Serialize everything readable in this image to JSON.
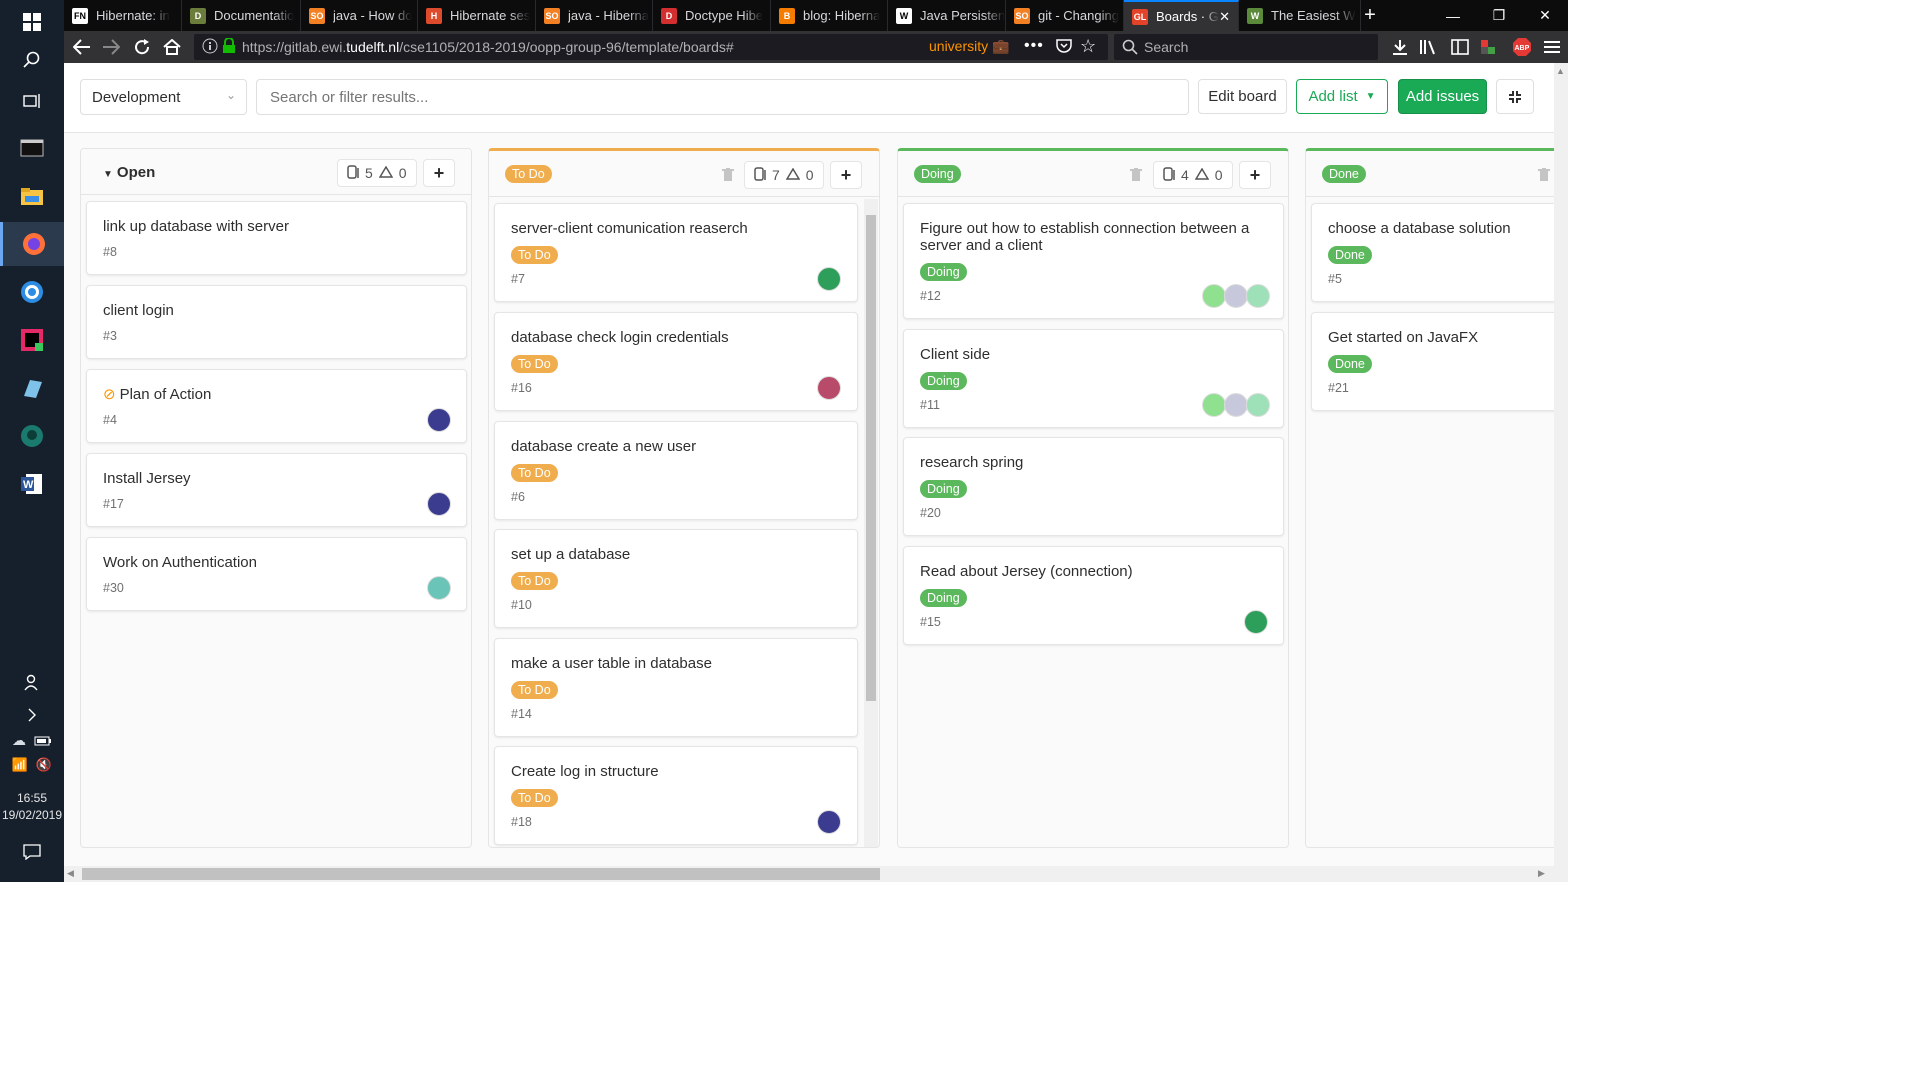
{
  "os": {
    "clock_time": "16:55",
    "clock_date": "19/02/2019"
  },
  "browser": {
    "tabs": [
      {
        "label": "Hibernate: in",
        "favicon": "FN",
        "color": "#ffffff"
      },
      {
        "label": "Documentatio",
        "favicon": "D",
        "color": "#6b7d3a"
      },
      {
        "label": "java - How do",
        "favicon": "SO",
        "color": "#f48024"
      },
      {
        "label": "Hibernate ses",
        "favicon": "H",
        "color": "#de4a2c"
      },
      {
        "label": "java - Hiberna",
        "favicon": "SO",
        "color": "#f48024"
      },
      {
        "label": "Doctype Hibe",
        "favicon": "D",
        "color": "#d32f2f"
      },
      {
        "label": "blog: Hiberna",
        "favicon": "B",
        "color": "#f57c00"
      },
      {
        "label": "Java Persisten",
        "favicon": "W",
        "color": "#ffffff"
      },
      {
        "label": "git - Changing",
        "favicon": "SO",
        "color": "#f48024"
      },
      {
        "label": "Boards · G",
        "favicon": "GL",
        "color": "#e24329",
        "active": true
      },
      {
        "label": "The Easiest W",
        "favicon": "W",
        "color": "#5a8a3a"
      }
    ],
    "url_prefix": "https://gitlab.ewi.",
    "url_domain": "tudelft.nl",
    "url_path": "/cse1105/2018-2019/oopp-group-96/template/boards#",
    "container_label": "university",
    "search_placeholder": "Search"
  },
  "toolbar": {
    "board_selector": "Development",
    "filter_placeholder": "Search or filter results...",
    "edit_board": "Edit board",
    "add_list": "Add list",
    "add_issues": "Add issues"
  },
  "colors": {
    "todo": "#f0ad4e",
    "doing": "#5cb85c",
    "done": "#5cb85c",
    "accent": "#1aaa55"
  },
  "lists": [
    {
      "title": "Open",
      "issues": "5",
      "weight": "0",
      "cards": [
        {
          "title": "link up database with server",
          "num": "#8"
        },
        {
          "title": "client login",
          "num": "#3"
        },
        {
          "title": "Plan of Action",
          "num": "#4",
          "confidential": true,
          "avatars": [
            "#3b3b8f"
          ]
        },
        {
          "title": "Install Jersey",
          "num": "#17",
          "avatars": [
            "#3b3b8f"
          ]
        },
        {
          "title": "Work on Authentication",
          "num": "#30",
          "avatars": [
            "#6ac5b8"
          ]
        }
      ]
    },
    {
      "title": "To Do",
      "issues": "7",
      "weight": "0",
      "cards": [
        {
          "title": "server-client comunication reaserch",
          "label": "To Do",
          "num": "#7",
          "avatars": [
            "#2e9e5b"
          ]
        },
        {
          "title": "database check login credentials",
          "label": "To Do",
          "num": "#16",
          "avatars": [
            "#b84a6a"
          ]
        },
        {
          "title": "database create a new user",
          "label": "To Do",
          "num": "#6"
        },
        {
          "title": "set up a database",
          "label": "To Do",
          "num": "#10"
        },
        {
          "title": "make a user table in database",
          "label": "To Do",
          "num": "#14"
        },
        {
          "title": "Create log in structure",
          "label": "To Do",
          "num": "#18",
          "avatars": [
            "#3b3b8f"
          ]
        }
      ]
    },
    {
      "title": "Doing",
      "issues": "4",
      "weight": "0",
      "cards": [
        {
          "title": "Figure out how to establish connection between a server and a client",
          "label": "Doing",
          "num": "#12",
          "avatars": [
            "#8fe08f",
            "#c8c8dc",
            "#9ee0b8"
          ]
        },
        {
          "title": "Client side",
          "label": "Doing",
          "num": "#11",
          "avatars": [
            "#8fe08f",
            "#c8c8dc",
            "#9ee0b8"
          ]
        },
        {
          "title": "research spring",
          "label": "Doing",
          "num": "#20"
        },
        {
          "title": "Read about Jersey (connection)",
          "label": "Doing",
          "num": "#15",
          "avatars": [
            "#2e9e5b"
          ]
        }
      ]
    },
    {
      "title": "Done",
      "cards": [
        {
          "title": "choose a database solution",
          "label": "Done",
          "num": "#5"
        },
        {
          "title": "Get started on JavaFX",
          "label": "Done",
          "num": "#21"
        }
      ]
    }
  ]
}
